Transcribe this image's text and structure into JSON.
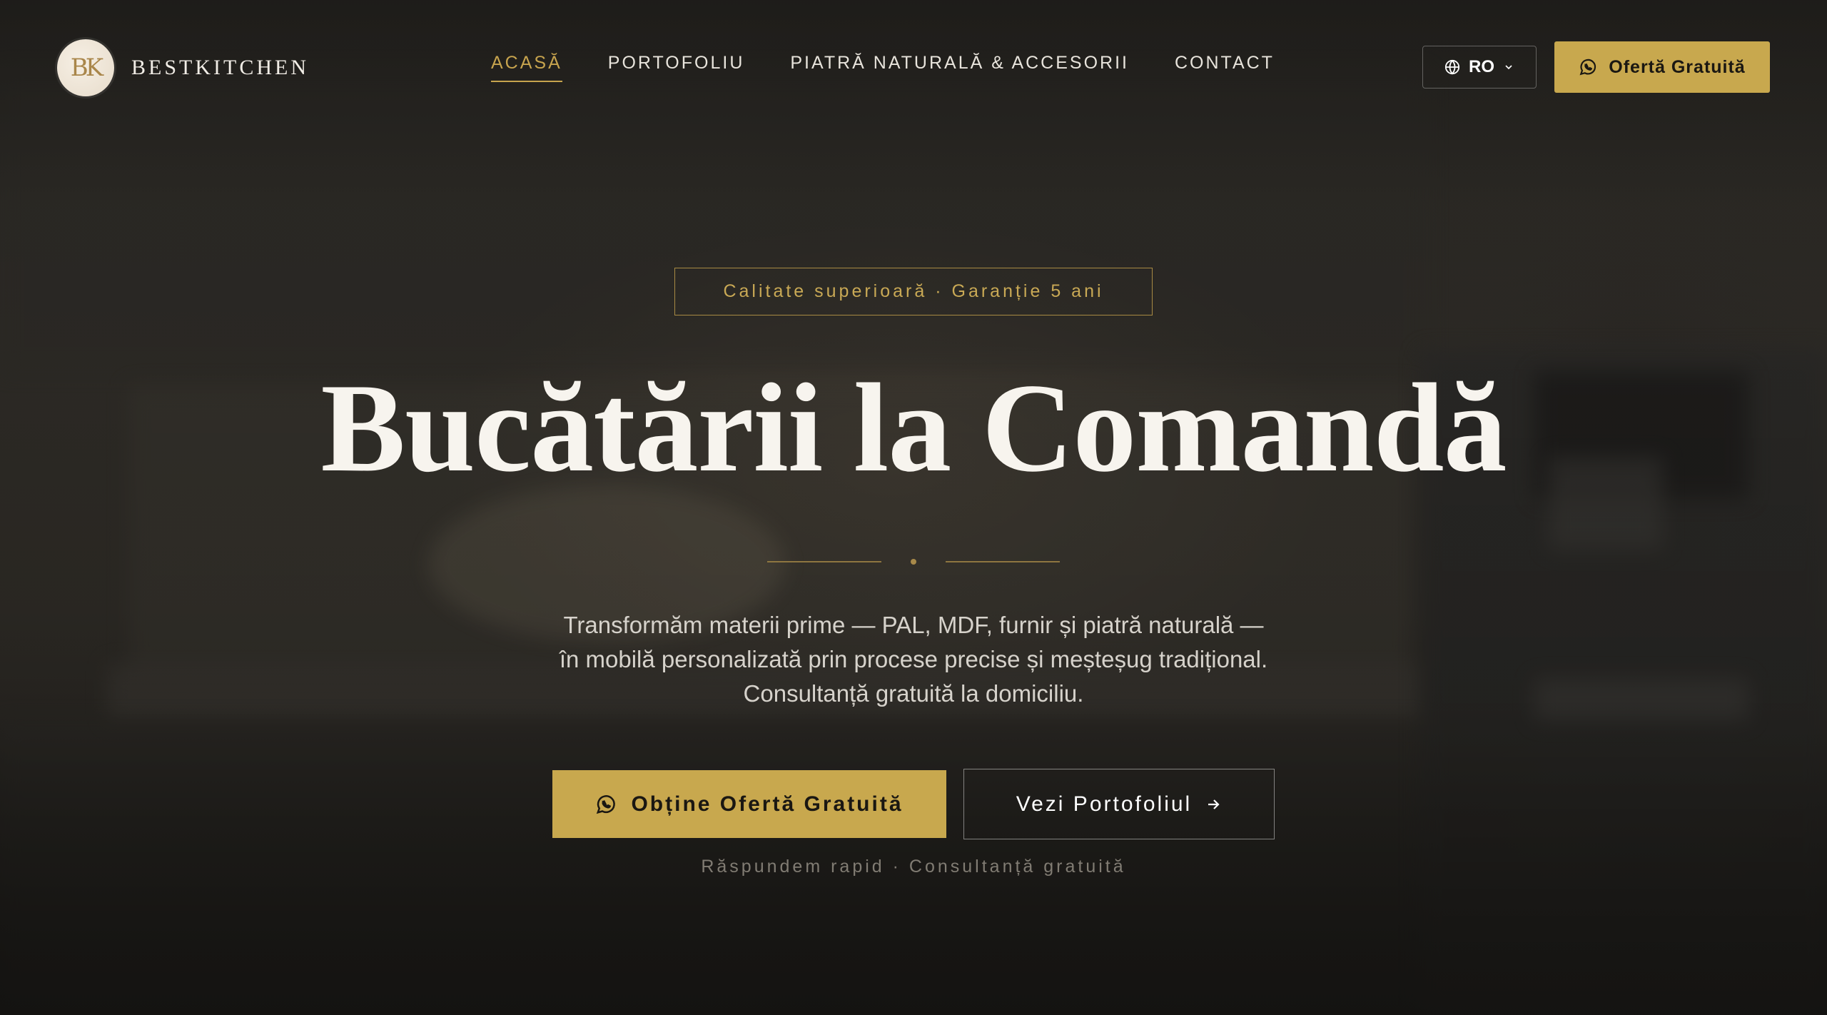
{
  "brand": {
    "logo_monogram": "BK",
    "name": "BESTKITCHEN"
  },
  "nav": {
    "items": [
      {
        "label": "ACASĂ",
        "active": true
      },
      {
        "label": "PORTOFOLIU",
        "active": false
      },
      {
        "label": "PIATRĂ NATURALĂ & ACCESORII",
        "active": false
      },
      {
        "label": "CONTACT",
        "active": false
      }
    ]
  },
  "language": {
    "selected": "RO",
    "icon": "globe-icon"
  },
  "header_cta": {
    "label": "Ofertă Gratuită",
    "icon": "whatsapp-icon"
  },
  "hero": {
    "badge": "Calitate superioară · Garanție 5 ani",
    "title": "Bucătării la Comandă",
    "subtitle": "Transformăm materii prime — PAL, MDF, furnir și piatră naturală — în mobilă personalizată prin procese precise și meșteșug tradițional. Consultanță gratuită la domiciliu.",
    "primary_button": "Obține Ofertă Gratuită",
    "secondary_button": "Vezi Portofoliul",
    "note": "Răspundem rapid · Consultanță gratuită"
  },
  "colors": {
    "accent": "#c8a84e",
    "background": "#1c1a17",
    "text": "#f7f4ee"
  }
}
